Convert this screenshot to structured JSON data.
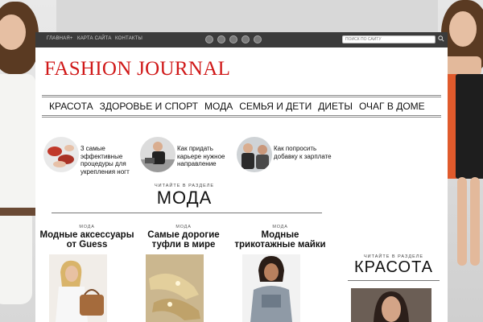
{
  "topbar": {
    "links": [
      "ГЛАВНАЯ+",
      "КАРТА САЙТА",
      "КОНТАКТЫ"
    ],
    "search_placeholder": "ПОИСК ПО САЙТУ"
  },
  "logo": "FASHION JOURNAL",
  "nav": [
    "КРАСОТА",
    "ЗДОРОВЬЕ И СПОРТ",
    "МОДА",
    "СЕМЬЯ И ДЕТИ",
    "ДИЕТЫ",
    "ОЧАГ В ДОМЕ"
  ],
  "promos": [
    {
      "text": "3 самые эффективные процедуры для укрепления ногт"
    },
    {
      "text": "Как придать карьере нужное направление"
    },
    {
      "text": "Как попросить добавку к зарплате"
    }
  ],
  "section_moda": {
    "kicker": "ЧИТАЙТЕ В РАЗДЕЛЕ",
    "title": "МОДА"
  },
  "cards": [
    {
      "kicker": "МОДА",
      "title": "Модные аксессуары от Guess"
    },
    {
      "kicker": "МОДА",
      "title": "Самые дорогие туфли в мире"
    },
    {
      "kicker": "МОДА",
      "title": "Модные трикотажные майки"
    }
  ],
  "section_beauty": {
    "kicker": "ЧИТАЙТЕ В РАЗДЕЛЕ",
    "title": "КРАСОТА"
  },
  "colors": {
    "logo": "#d01818",
    "topbar": "#3b3b3b"
  }
}
